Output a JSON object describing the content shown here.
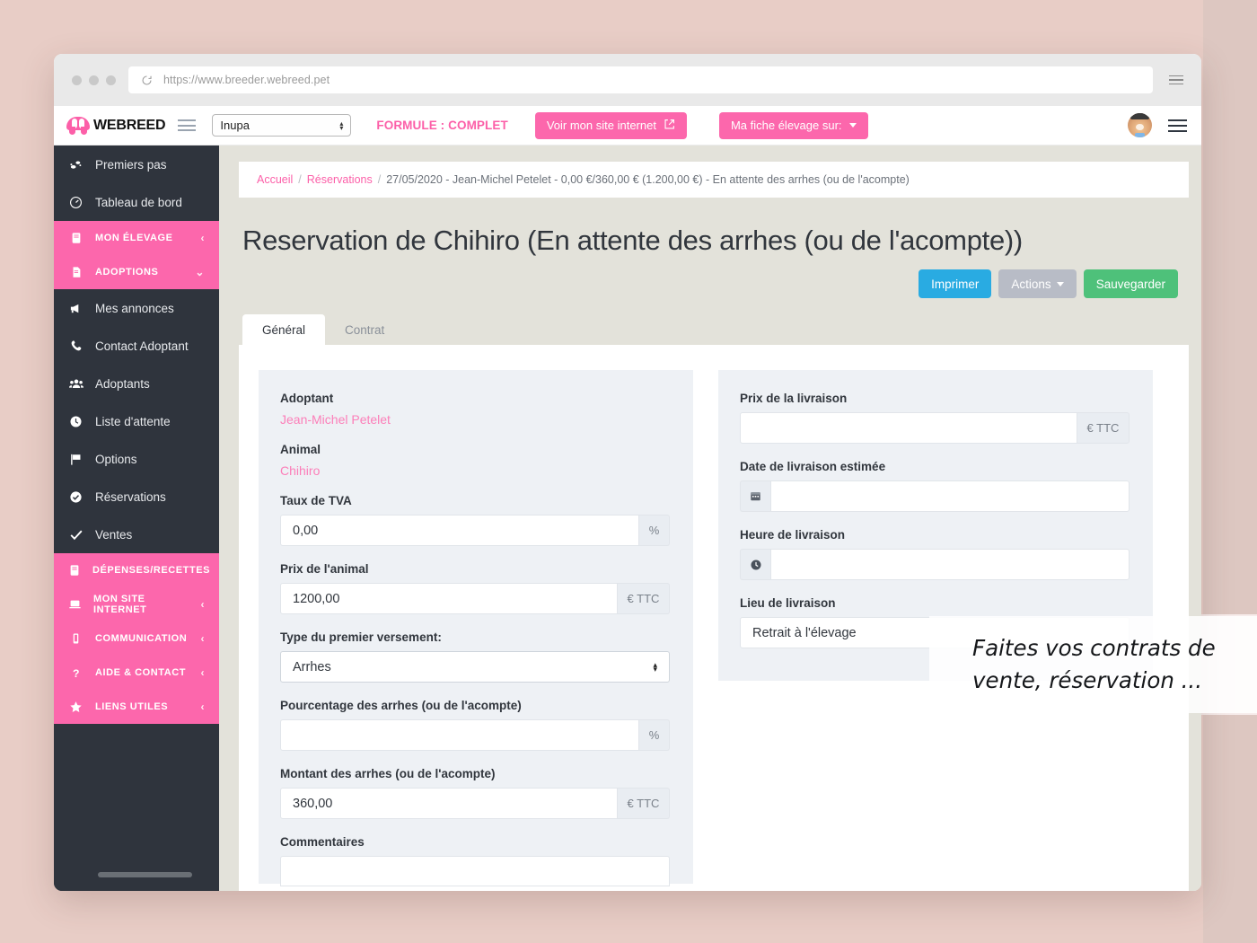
{
  "browser": {
    "url": "https://www.breeder.webreed.pet",
    "reload_icon": "reload-icon",
    "menu_icon": "hamburger-icon"
  },
  "topbar": {
    "brand": "WEBREED",
    "menu_icon": "hamburger-icon",
    "elevage_select_value": "Inupa",
    "formule_label": "FORMULE : COMPLET",
    "voir_site_label": "Voir mon site internet",
    "external_link_icon": "external-link-icon",
    "fiche_elevage_label": "Ma fiche élevage sur:",
    "avatar_icon": "avatar-dog-icon",
    "user_menu_icon": "hamburger-icon"
  },
  "sidebar": {
    "items": [
      {
        "label": "Premiers pas",
        "icon": "footsteps-icon",
        "type": "link"
      },
      {
        "label": "Tableau de bord",
        "icon": "dashboard-icon",
        "type": "link"
      },
      {
        "label": "MON ÉLEVAGE",
        "icon": "book-icon",
        "type": "group",
        "chevron": "‹"
      },
      {
        "label": "ADOPTIONS",
        "icon": "file-icon",
        "type": "group",
        "chevron": "⌄"
      },
      {
        "label": "Mes annonces",
        "icon": "megaphone-icon",
        "type": "link"
      },
      {
        "label": "Contact Adoptant",
        "icon": "phone-icon",
        "type": "link"
      },
      {
        "label": "Adoptants",
        "icon": "users-icon",
        "type": "link"
      },
      {
        "label": "Liste d'attente",
        "icon": "clock-icon",
        "type": "link"
      },
      {
        "label": "Options",
        "icon": "flag-icon",
        "type": "link"
      },
      {
        "label": "Réservations",
        "icon": "check-circle-icon",
        "type": "link"
      },
      {
        "label": "Ventes",
        "icon": "check-icon",
        "type": "link"
      }
    ],
    "lower_items": [
      {
        "label": "DÉPENSES/RECETTES",
        "icon": "book-icon",
        "chevron": "‹"
      },
      {
        "label": "MON SITE INTERNET",
        "icon": "laptop-icon",
        "chevron": "‹"
      },
      {
        "label": "COMMUNICATION",
        "icon": "mobile-icon",
        "chevron": "‹"
      },
      {
        "label": "AIDE & CONTACT",
        "icon": "question-icon",
        "chevron": "‹"
      },
      {
        "label": "LIENS UTILES",
        "icon": "star-icon",
        "chevron": "‹"
      }
    ]
  },
  "breadcrumb": {
    "home": "Accueil",
    "section": "Réservations",
    "current": "27/05/2020 - Jean-Michel Petelet - 0,00 €/360,00 € (1.200,00 €) - En attente des arrhes (ou de l'acompte)",
    "separator": "/"
  },
  "page": {
    "title": "Reservation de Chihiro (En attente des arrhes (ou de l'acompte))"
  },
  "actions": {
    "imprimer": "Imprimer",
    "actions": "Actions",
    "sauvegarder": "Sauvegarder"
  },
  "tabs": [
    {
      "label": "Général",
      "active": true
    },
    {
      "label": "Contrat",
      "active": false
    }
  ],
  "form_left": {
    "adoptant_label": "Adoptant",
    "adoptant_value": "Jean-Michel Petelet",
    "animal_label": "Animal",
    "animal_value": "Chihiro",
    "tva_label": "Taux de TVA",
    "tva_value": "0,00",
    "tva_addon": "%",
    "prix_animal_label": "Prix de l'animal",
    "prix_animal_value": "1200,00",
    "prix_animal_addon": "€ TTC",
    "type_versement_label": "Type du premier versement:",
    "type_versement_value": "Arrhes",
    "pourcentage_label": "Pourcentage des arrhes (ou de l'acompte)",
    "pourcentage_value": "",
    "pourcentage_addon": "%",
    "montant_label": "Montant des arrhes (ou de l'acompte)",
    "montant_value": "360,00",
    "montant_addon": "€ TTC",
    "commentaires_label": "Commentaires",
    "commentaires_value": ""
  },
  "form_right": {
    "prix_livraison_label": "Prix de la livraison",
    "prix_livraison_value": "",
    "prix_livraison_addon": "€ TTC",
    "date_livraison_label": "Date de livraison estimée",
    "date_livraison_value": "",
    "date_icon": "calendar-icon",
    "heure_livraison_label": "Heure de livraison",
    "heure_livraison_value": "",
    "heure_icon": "clock-icon",
    "lieu_livraison_label": "Lieu de livraison",
    "lieu_livraison_value": "Retrait à l'élevage"
  },
  "overlay": {
    "caption": "Faites vos contrats de vente, réservation ..."
  },
  "colors": {
    "brand_pink": "#fc67ac",
    "sidebar_dark": "#2f343d",
    "accent_blue": "#29abe2",
    "accent_green": "#4ec17a",
    "accent_grey": "#b8bcc6",
    "page_bg": "#e3e2da",
    "card_bg": "#eef1f5"
  }
}
